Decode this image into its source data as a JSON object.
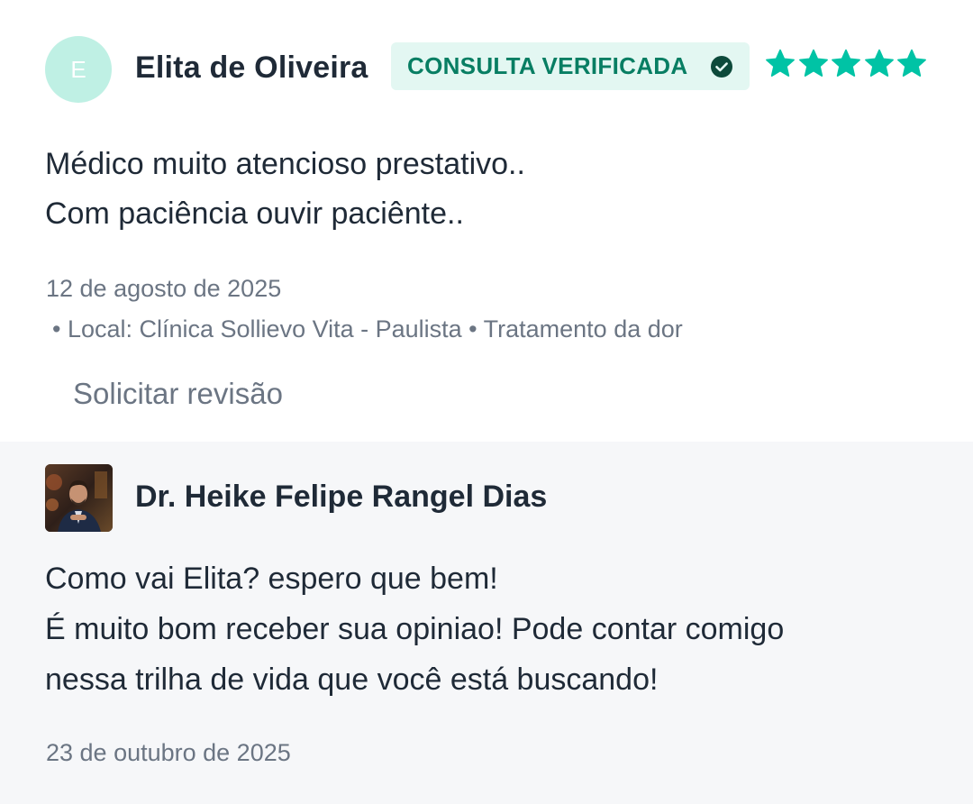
{
  "review": {
    "avatar_initial": "E",
    "reviewer_name": "Elita de Oliveira",
    "badge_label": "CONSULTA VERIFICADA",
    "rating": 5,
    "rating_max": 5,
    "text_lines": [
      "Médico muito atencioso prestativo..",
      "Com paciência ouvir paciênte.."
    ],
    "date": "12 de agosto de 2025",
    "meta": "• Local: Clínica Sollievo Vita - Paulista • Tratamento da dor",
    "request_revision_label": "Solicitar revisão"
  },
  "reply": {
    "doctor_name": "Dr. Heike Felipe Rangel Dias",
    "text_lines": [
      "Como vai Elita? espero que bem!",
      "É muito bom receber sua opiniao! Pode contar comigo",
      "nessa trilha de vida que você está buscando!"
    ],
    "date": "23 de outubro de 2025"
  },
  "colors": {
    "accent_green": "#00c3a5",
    "badge_bg": "#e3f7f2",
    "badge_text": "#087e63",
    "avatar_bg": "#bff0e4",
    "reply_bg": "#f6f7f9",
    "muted_text": "#6b7583"
  },
  "icons": {
    "verified": "check-circle-icon",
    "rating": "star-icon"
  }
}
